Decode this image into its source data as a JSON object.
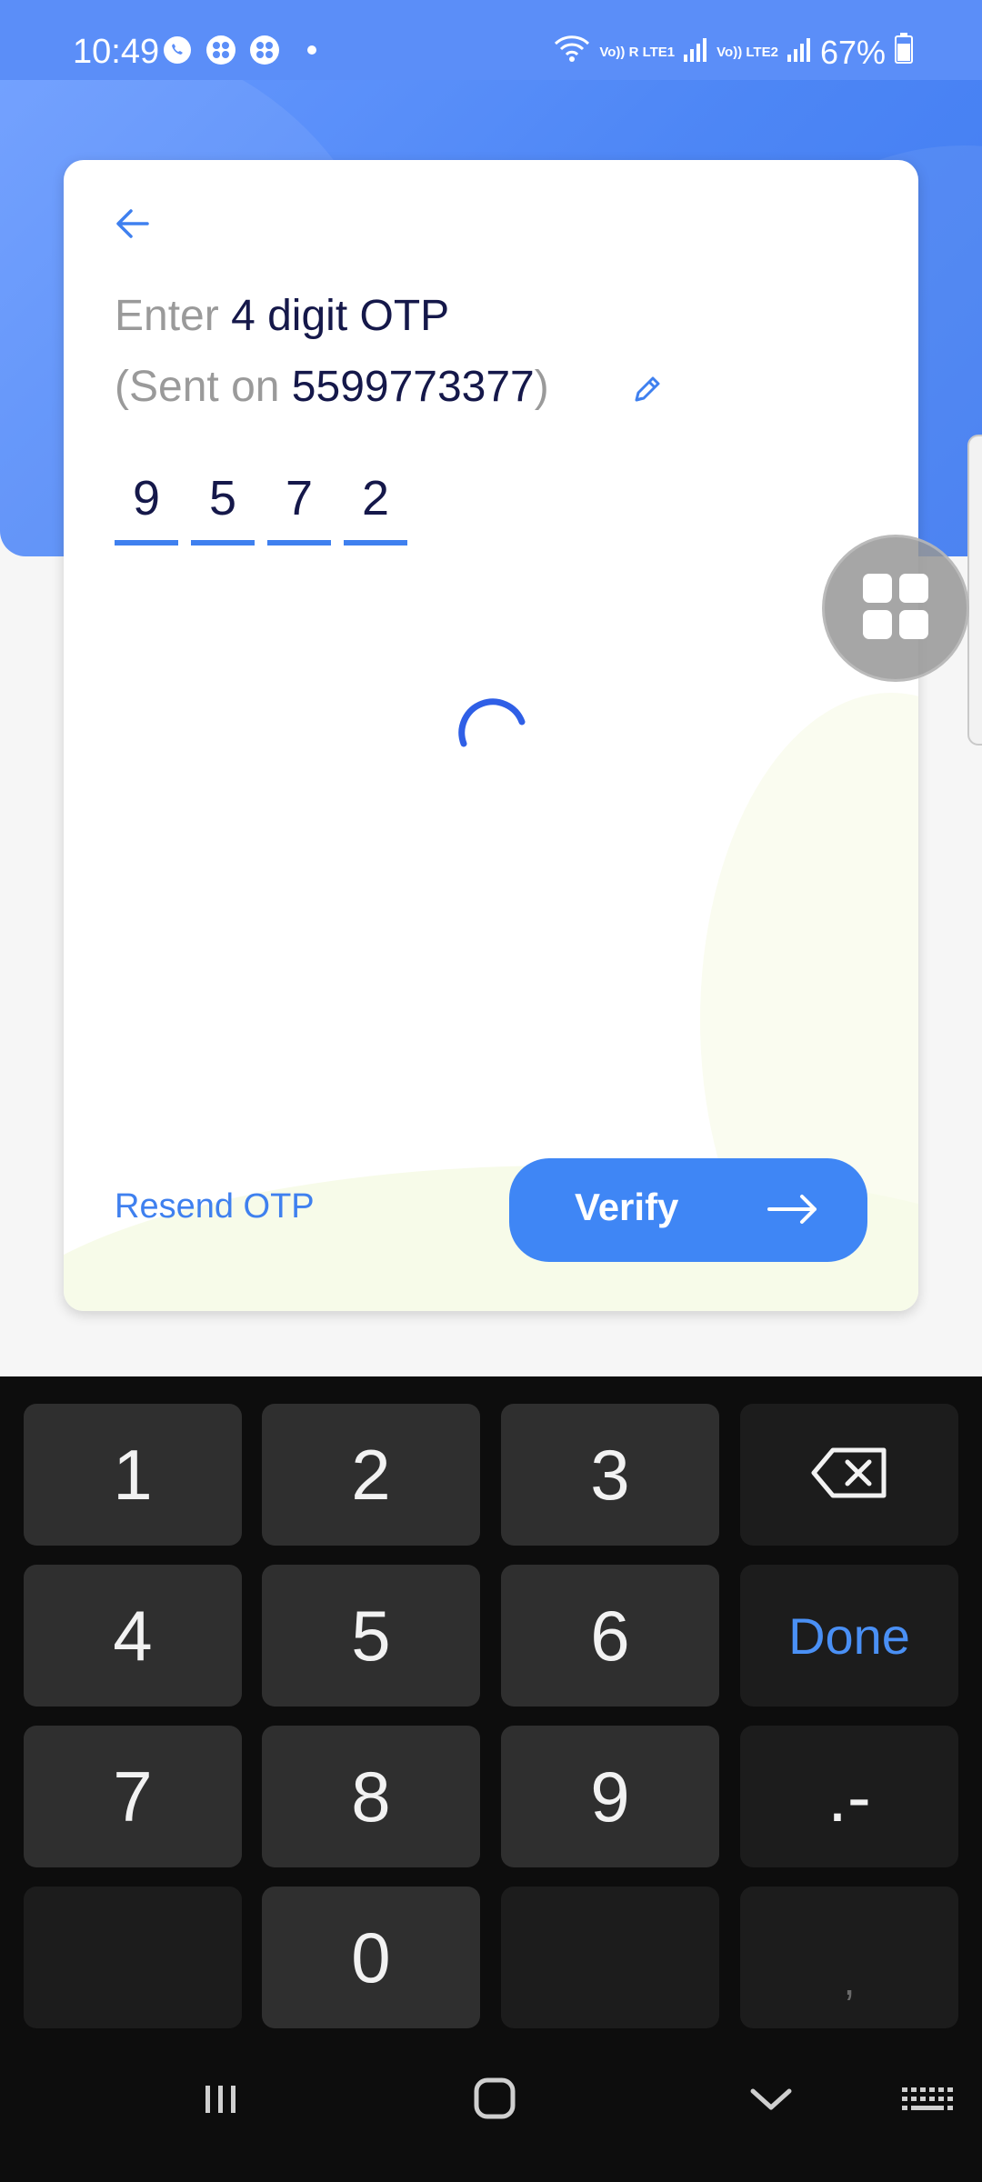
{
  "status_bar": {
    "time": "10:49",
    "left_icons": [
      "whatsapp-icon",
      "app-icon",
      "app-icon"
    ],
    "sim1_label": "Vo)) R LTE1",
    "sim2_label": "Vo)) LTE2",
    "battery": "67%"
  },
  "otp_screen": {
    "title_prefix": "Enter",
    "title_main": "4 digit OTP",
    "sent_prefix": "(Sent on",
    "phone": "5599773377",
    "sent_suffix": ")",
    "digits": [
      "9",
      "5",
      "7",
      "2"
    ],
    "resend_label": "Resend OTP",
    "verify_label": "Verify",
    "loading": true
  },
  "keyboard": {
    "rows": [
      [
        "1",
        "2",
        "3",
        "backspace"
      ],
      [
        "4",
        "5",
        "6",
        "Done"
      ],
      [
        "7",
        "8",
        "9",
        ".-"
      ],
      [
        "",
        "0",
        "",
        ","
      ]
    ],
    "done_label": "Done",
    "symbols_label": ".-",
    "comma_label": ","
  },
  "colors": {
    "accent": "#3f80ef",
    "header_bg": "#4d86f5",
    "dark_text": "#15184a",
    "keyboard_bg": "#0d0d0d"
  }
}
